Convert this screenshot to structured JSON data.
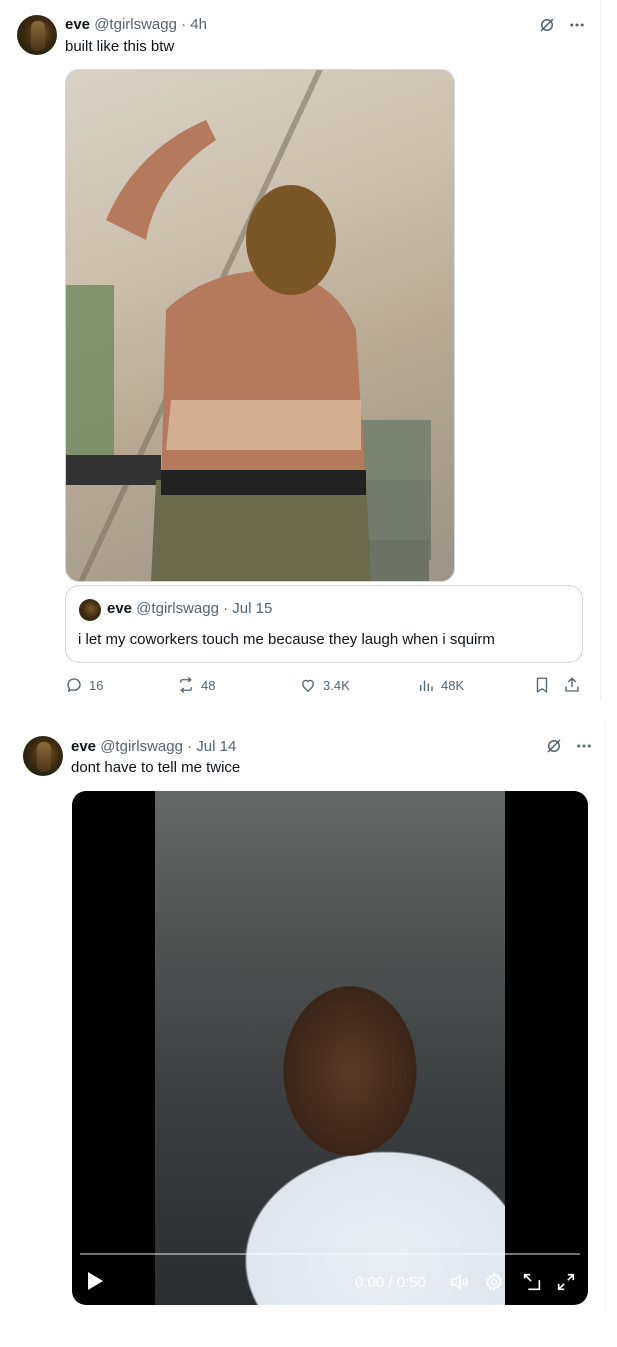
{
  "tweets": [
    {
      "author": {
        "name": "eve",
        "handle": "@tgirlswagg",
        "time": "· 4h"
      },
      "text": "built like this btw",
      "quote": {
        "author": {
          "name": "eve",
          "handle": "@tgirlswagg",
          "time": "· Jul 15"
        },
        "text": "i let my coworkers touch me because they laugh when i squirm"
      },
      "actions": {
        "replies": "16",
        "reposts": "48",
        "likes": "3.4K",
        "views": "48K"
      }
    },
    {
      "author": {
        "name": "eve",
        "handle": "@tgirlswagg",
        "time": "· Jul 14"
      },
      "text": "dont have to tell me twice",
      "video": {
        "time": "0:00 / 0:50"
      }
    }
  ],
  "icons": {
    "grok": "grok-icon",
    "more": "more-icon",
    "reply": "reply-icon",
    "repost": "repost-icon",
    "like": "heart-icon",
    "views": "analytics-icon",
    "bookmark": "bookmark-icon",
    "share": "share-icon",
    "play": "play-icon",
    "volume": "volume-icon",
    "settings": "settings-icon",
    "pip": "pip-icon",
    "fullscreen": "fullscreen-icon"
  },
  "colors": {
    "text": "#0f1419",
    "muted": "#536471",
    "border": "#cfd9de"
  }
}
